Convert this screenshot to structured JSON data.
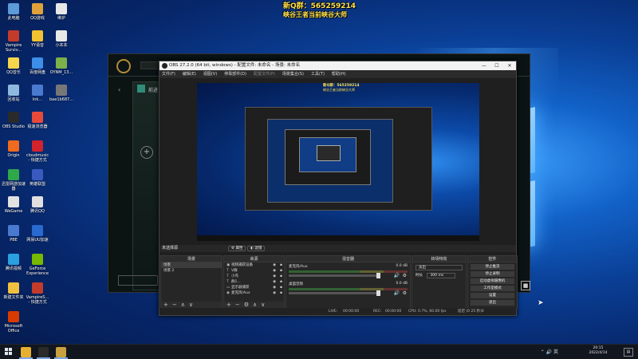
{
  "overlay": {
    "title": "新Q群：565259214",
    "subtitle": "峡谷王者当前峡谷大师"
  },
  "desktop_icons": [
    {
      "label": "此电脑",
      "color": "#5c9ad8"
    },
    {
      "label": "QQ游戏",
      "color": "#e0a13a"
    },
    {
      "label": "维护",
      "color": "#e8e8e8"
    },
    {
      "label": "Vampire Surviv...",
      "color": "#c23b2b"
    },
    {
      "label": "YY语音",
      "color": "#f2c230"
    },
    {
      "label": "小本本",
      "color": "#e8e8e8"
    },
    {
      "label": "QQ音乐",
      "color": "#f6d64a"
    },
    {
      "label": "百度网盘",
      "color": "#3c8ee8"
    },
    {
      "label": "OYNM_13...",
      "color": "#7bb04a"
    },
    {
      "label": "回收站",
      "color": "#8fb8de"
    },
    {
      "label": "lnk...",
      "color": "#4a7ad0"
    },
    {
      "label": "bae1b687...",
      "color": "#777777"
    },
    {
      "label": "OBS Studio",
      "color": "#2a2a2a"
    },
    {
      "label": "Origin",
      "color": "#f06a1f"
    },
    {
      "label": "极速浏览器",
      "color": "#e84a3a"
    },
    {
      "label": "迅雷网游加速器",
      "color": "#2fa84a"
    },
    {
      "label": "cloudmusic - 快捷方式",
      "color": "#d0232c"
    },
    {
      "label": "WeGame",
      "color": "#e2e2e2"
    },
    {
      "label": "英雄联盟",
      "color": "#3a5ac0"
    },
    {
      "label": "PBE",
      "color": "#4a7ad0"
    },
    {
      "label": "腾讯QQ",
      "color": "#e0e0e0"
    },
    {
      "label": "腾讯视频",
      "color": "#2aa0e0"
    },
    {
      "label": "网易UU加速",
      "color": "#2a6ad0"
    },
    {
      "label": "新建文件夹",
      "color": "#f0c040"
    },
    {
      "label": "GeForce Experience",
      "color": "#76b900"
    },
    {
      "label": "Microsoft Office",
      "color": "#d83b01"
    },
    {
      "label": "VampireS... - 快捷方式",
      "color": "#c23b2b"
    }
  ],
  "obs": {
    "title": "OBS 27.2.0 (64 bit, windows) - 配置文件: 未命名 - 场景: 未命名",
    "controls": [
      "—",
      "☐",
      "✕"
    ],
    "menu": [
      "文件(F)",
      "编辑(E)",
      "视图(V)",
      "停靠部件(D)",
      "配置文件(P)",
      "场景集合(S)",
      "工具(T)",
      "帮助(H)"
    ],
    "scene_toolbar": {
      "no_source": "未选择源",
      "properties": "属性",
      "filters": "滤镜"
    },
    "scenes": {
      "header": "场景",
      "items": [
        "场景",
        "场景 2"
      ]
    },
    "sources": {
      "header": "来源",
      "items": [
        {
          "name": "视频捕获设备",
          "icon": "▣"
        },
        {
          "name": "V群",
          "icon": "T"
        },
        {
          "name": "小鸟",
          "icon": "T"
        },
        {
          "name": "群1...",
          "icon": "T"
        },
        {
          "name": "显示器捕获",
          "icon": "▭"
        },
        {
          "name": "麦克风/Aux",
          "icon": "◉"
        }
      ]
    },
    "mixer": {
      "header": "混音器",
      "items": [
        {
          "name": "麦克风/Aux",
          "value": "0.0 dB"
        },
        {
          "name": "桌面音频",
          "value": "0.0 dB"
        }
      ]
    },
    "transitions": {
      "header": "转场特效",
      "type": "淡出",
      "duration_label": "时长",
      "duration": "300 ms"
    },
    "controls_dock": {
      "header": "控件",
      "buttons": [
        "停止推流",
        "停止录制",
        "启动虚拟摄像机",
        "工作室模式",
        "设置",
        "退出"
      ]
    },
    "footer_buttons": [
      "+",
      "−",
      "⚙",
      "∧",
      "∨"
    ],
    "status": {
      "live_label": "LIVE:",
      "live_time": "00:00:00",
      "rec_label": "REC:",
      "rec_time": "00:00:00",
      "cpu": "CPU: 0.7%, 60.00 fps",
      "dropped": "延迟 (0 25 秒)0"
    },
    "preview": {
      "title": "新Q群：565259214",
      "subtitle": "峡谷王者当前峡谷大师"
    }
  },
  "game_client": {
    "tile_text": "前进"
  },
  "taskbar": {
    "time": "20:15",
    "date": "2022/4/14",
    "tray_text": "英",
    "apps": [
      {
        "name": "chrome",
        "color": "#e8b030"
      },
      {
        "name": "obs",
        "color": "#2a2a2a"
      },
      {
        "name": "league",
        "color": "#c8a040"
      }
    ]
  }
}
